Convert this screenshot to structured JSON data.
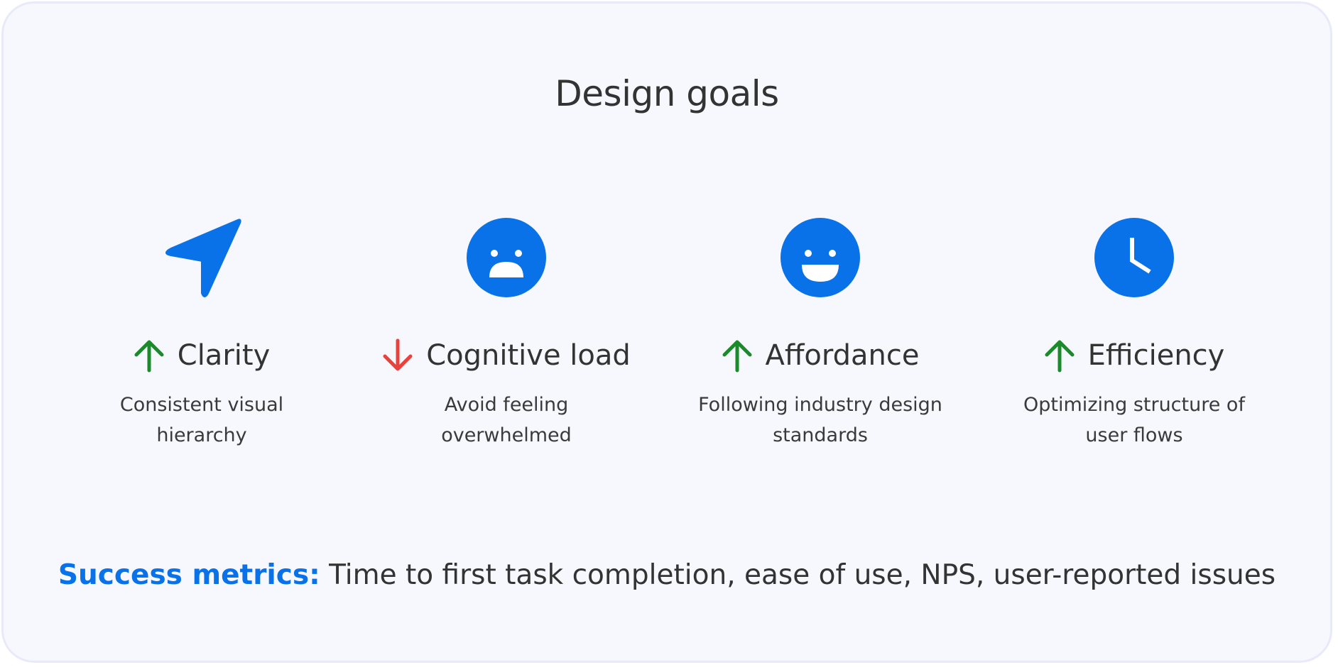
{
  "title": "Design goals",
  "colors": {
    "accent": "#0a72e8",
    "up": "#1b8a2a",
    "down": "#e8423f",
    "text": "#333333",
    "background": "#f7f8fd"
  },
  "goals": [
    {
      "icon": "navigation-arrow-icon",
      "trend": "up",
      "label": "Clarity",
      "description_line1": "Consistent visual",
      "description_line2": "hierarchy"
    },
    {
      "icon": "sad-face-icon",
      "trend": "down",
      "label": "Cognitive load",
      "description_line1": "Avoid feeling",
      "description_line2": "overwhelmed"
    },
    {
      "icon": "happy-face-icon",
      "trend": "up",
      "label": "Affordance",
      "description_line1": "Following industry design",
      "description_line2": "standards"
    },
    {
      "icon": "clock-icon",
      "trend": "up",
      "label": "Efficiency",
      "description_line1": "Optimizing structure of",
      "description_line2": "user flows"
    }
  ],
  "metrics": {
    "label": "Success metrics:",
    "text": " Time to first task completion, ease of use, NPS, user-reported issues"
  }
}
